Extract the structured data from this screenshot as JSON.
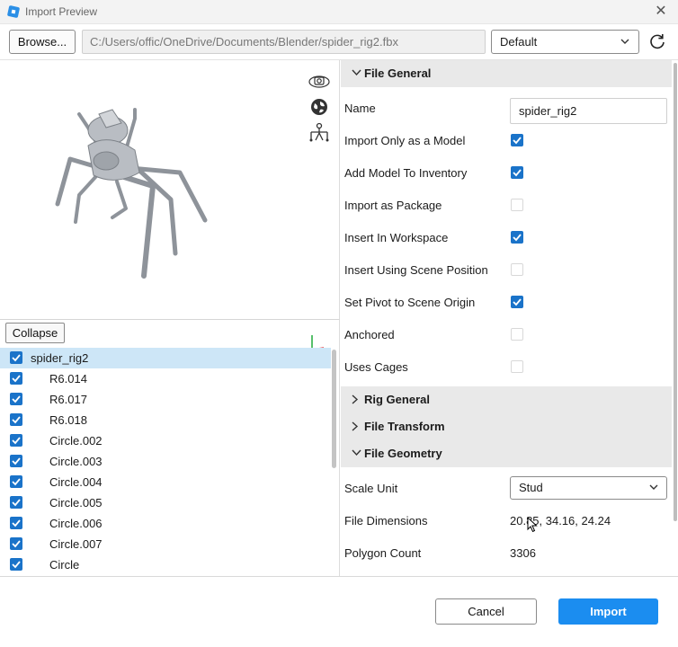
{
  "window": {
    "title": "Import Preview"
  },
  "toolbar": {
    "browse_label": "Browse...",
    "file_path": "C:/Users/offic/OneDrive/Documents/Blender/spider_rig2.fbx",
    "preset": "Default"
  },
  "tree": {
    "collapse_label": "Collapse",
    "items": [
      {
        "label": "spider_rig2",
        "checked": true
      },
      {
        "label": "R6.014",
        "checked": true
      },
      {
        "label": "R6.017",
        "checked": true
      },
      {
        "label": "R6.018",
        "checked": true
      },
      {
        "label": "Circle.002",
        "checked": true
      },
      {
        "label": "Circle.003",
        "checked": true
      },
      {
        "label": "Circle.004",
        "checked": true
      },
      {
        "label": "Circle.005",
        "checked": true
      },
      {
        "label": "Circle.006",
        "checked": true
      },
      {
        "label": "Circle.007",
        "checked": true
      },
      {
        "label": "Circle",
        "checked": true
      }
    ]
  },
  "props": {
    "file_general": {
      "title": "File General",
      "name_label": "Name",
      "name_value": "spider_rig2",
      "options": [
        {
          "label": "Import Only as a Model",
          "checked": true
        },
        {
          "label": "Add Model To Inventory",
          "checked": true
        },
        {
          "label": "Import as Package",
          "checked": false
        },
        {
          "label": "Insert In Workspace",
          "checked": true
        },
        {
          "label": "Insert Using Scene Position",
          "checked": false
        },
        {
          "label": "Set Pivot to Scene Origin",
          "checked": true
        },
        {
          "label": "Anchored",
          "checked": false
        },
        {
          "label": "Uses Cages",
          "checked": false
        }
      ]
    },
    "rig_general": {
      "title": "Rig General"
    },
    "file_transform": {
      "title": "File Transform"
    },
    "file_geometry": {
      "title": "File Geometry",
      "scale_unit_label": "Scale Unit",
      "scale_unit_value": "Stud",
      "dimensions_label": "File Dimensions",
      "dimensions_value": "20.85, 34.16, 24.24",
      "polygon_label": "Polygon Count",
      "polygon_value": "3306"
    }
  },
  "footer": {
    "cancel_label": "Cancel",
    "import_label": "Import"
  },
  "colors": {
    "accent": "#1b8df0",
    "checkbox": "#1a73c9",
    "selection": "#cde6f7"
  }
}
